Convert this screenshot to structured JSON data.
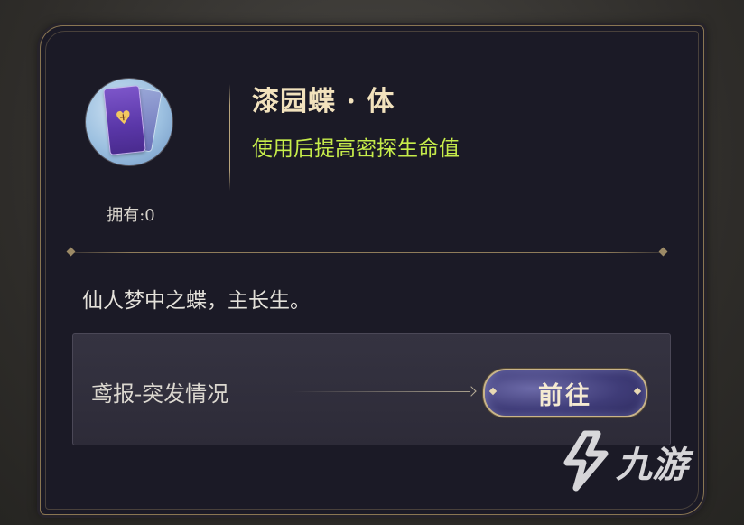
{
  "item": {
    "name": "漆园蝶 · 体",
    "effect": "使用后提高密探生命值",
    "owned": "拥有:0",
    "description": "仙人梦中之蝶，主长生。",
    "icon": "purple-card-icon"
  },
  "source": {
    "label": "鸢报-突发情况",
    "button_label": "前往"
  },
  "watermark": {
    "text": "九游",
    "icon": "jiuyou-logo"
  },
  "colors": {
    "title": "#f2e2bd",
    "effect": "#c6ec4a",
    "panel": "#1b1a26",
    "border_gold": "#8a7652"
  }
}
